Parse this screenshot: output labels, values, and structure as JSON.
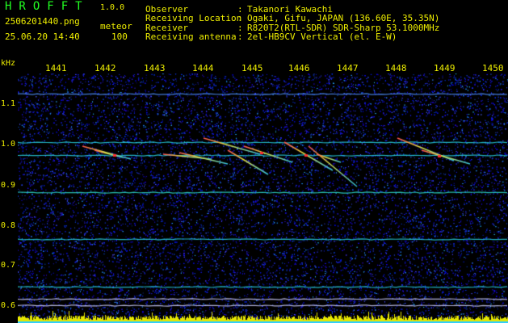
{
  "header": {
    "app_title": "HROFFT",
    "app_version": "1.0.0",
    "file_name": "2506201440.png",
    "datetime": "25.06.20 14:40",
    "meteor_label": "meteor",
    "meteor_count": "100",
    "info": [
      {
        "label": "Observer",
        "value": "Takanori Kawachi"
      },
      {
        "label": "Receiving Location",
        "value": "Ogaki, Gifu, JAPAN (136.60E, 35.35N)"
      },
      {
        "label": "Receiver",
        "value": "R820T2(RTL-SDR) SDR-Sharp 53.1000MHz"
      },
      {
        "label": "Receiving antenna",
        "value": "2el-HB9CV Vertical (el. E-W)"
      }
    ]
  },
  "axes": {
    "freq_unit": "kHz",
    "freq_ticks": [
      "1.1",
      "1.0",
      "0.9",
      "0.8",
      "0.7",
      "0.6"
    ],
    "time_ticks": [
      "1441",
      "1442",
      "1443",
      "1444",
      "1445",
      "1446",
      "1447",
      "1448",
      "1449",
      "1450"
    ]
  },
  "colors": {
    "background": "#000000",
    "noise": "#1a2fd8",
    "text": "#eeee00",
    "title": "#22ff22",
    "carrier": "#20c8e0",
    "meteor_head": "#ff4040",
    "meteor_trail": "#e0e040",
    "floor_bar": "#e6e600"
  }
}
